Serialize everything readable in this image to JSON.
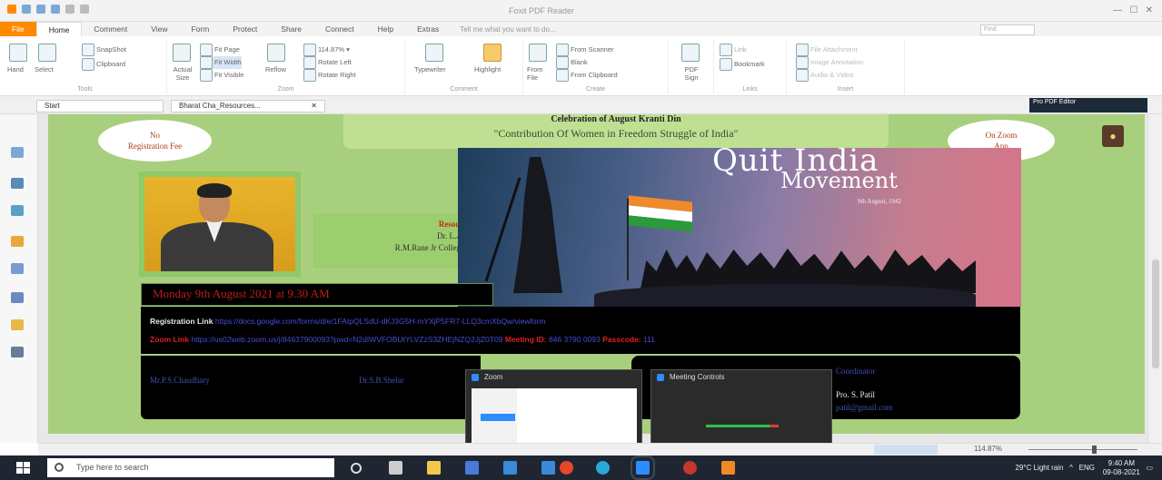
{
  "window": {
    "title": "Foxit PDF Reader",
    "tabs": [
      "File",
      "Home",
      "Comment",
      "View",
      "Form",
      "Protect",
      "Share",
      "Connect",
      "Help",
      "Extras"
    ],
    "tell_me": "Tell me what you want to do...",
    "search_placeholder": "Find"
  },
  "ribbon": {
    "groups": [
      "Tools",
      "Zoom",
      "Comment",
      "Create",
      "Links",
      "Insert"
    ],
    "hand": "Hand",
    "select": "Select",
    "snapshot": "SnapShot",
    "clipboard": "Clipboard",
    "actual_size": "Actual Size",
    "fit_page": "Fit Page",
    "fit_width": "Fit Width",
    "fit_visible": "Fit Visible",
    "reflow": "Reflow",
    "zoom_value": "114.87%",
    "rotate_left": "Rotate Left",
    "rotate_right": "Rotate Right",
    "typewriter": "Typewriter",
    "highlight": "Highlight",
    "from_file": "From File",
    "from_scanner": "From Scanner",
    "blank": "Blank",
    "from_clipboard": "From Clipboard",
    "pdf_sign": "PDF Sign",
    "link": "Link",
    "bookmark": "Bookmark",
    "file_attachment": "File Attachment",
    "image_annotation": "Image Annotation",
    "audio_video": "Audio & Video"
  },
  "doc_tabs": [
    "Start",
    "Bharat Cha_Resources..."
  ],
  "promo": "Pro PDF Editor",
  "poster": {
    "header_line1": "Celebration of August Kranti Din",
    "header_line2": "\"Contribution Of Women in Freedom Struggle of India\"",
    "left_oval": "No\nRegistration Fee",
    "right_oval": "On Zoom\nApp",
    "resource_label": "Resource Person",
    "resource_name": "Dr. L.A.Nalawade",
    "resource_college": "R.M.Rane Jr College Kolhapur",
    "banner_title1": "Quit India",
    "banner_title2": "Movement",
    "banner_date": "9th August, 1942",
    "date_line": "Monday 9th August 2021 at 9.30 AM",
    "reg_label": "Registration Link",
    "reg_url": "https://docs.google.com/forms/d/e/1FAIpQLSdU-dKJ3G5H-mYXjP5FR7-LLQ3cmXbQw/viewform",
    "zoom_label": "Zoom Link",
    "zoom_url": "https://us02web.zoom.us/j/84637900093?pwd=N2dIWVFOBUtYLVZzS3ZHEjNZQ2JjZ0T09",
    "meeting_label": "Meeting ID:",
    "meeting_id": "846 3790 0093",
    "passcode_label": "Passcode:",
    "passcode": "111",
    "name1": "Mr.P.S.Chaudhary",
    "name2": "Dr.S.B.Shelar",
    "name3": "Coordinator",
    "name4": "Pro. S. Patil",
    "name4_email": "patil@gmail.com"
  },
  "popups": {
    "zoom": "Zoom",
    "meeting_controls": "Meeting Controls"
  },
  "status": {
    "zoom": "114.87%"
  },
  "taskbar": {
    "search": "Type here to search",
    "weather": "29°C Light rain",
    "time": "9:40 AM",
    "date": "09-08-2021",
    "lang": "ENG"
  }
}
